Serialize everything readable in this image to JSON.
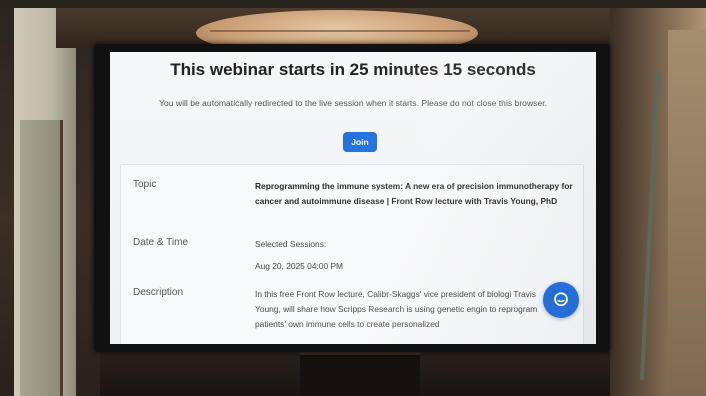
{
  "webinar": {
    "countdown_title": "This webinar starts in 25 minutes 15 seconds",
    "redirect_note": "You will be automatically redirected to the live session when it starts. Please do not close this browser.",
    "join_label": "Join"
  },
  "details": {
    "topic_label": "Topic",
    "topic_value": "Reprogramming the immune system: A new era of precision immunotherapy for cancer and autoimmune disease | Front Row lecture with Travis Young, PhD",
    "datetime_label": "Date & Time",
    "sessions_label": "Selected Sessions:",
    "session_value": "Aug 20, 2025 04:00 PM",
    "description_label": "Description",
    "description_value": "In this free Front Row lecture, Calibr-Skaggs' vice president of biologi Travis Young, will share how Scripps Research is using genetic engin to reprogram patients' own immune cells to create personalized"
  },
  "icons": {
    "chat": "chat-bubble-icon"
  },
  "colors": {
    "accent": "#1f6fe0",
    "background": "#f6f7f8",
    "title_text": "#222222"
  }
}
